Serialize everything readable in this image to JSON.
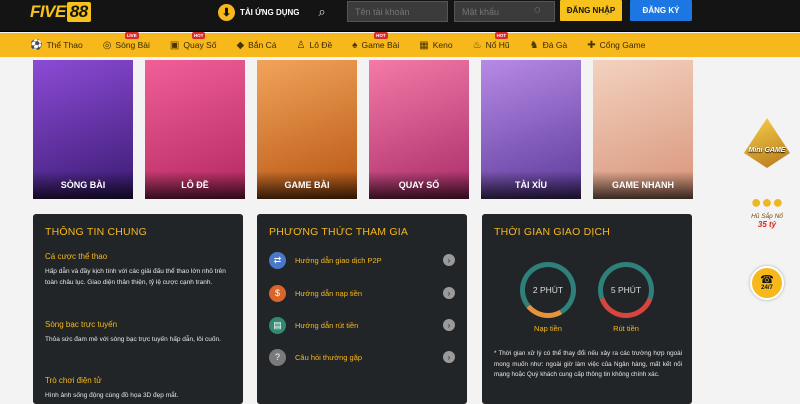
{
  "header": {
    "logo_part1": "FIVE",
    "logo_part2": "88",
    "app_download_label": "TẢI ỨNG DỤNG",
    "username_placeholder": "Tên tài khoản",
    "password_placeholder": "Mật khẩu",
    "login_label": "ĐĂNG NHẬP",
    "register_label": "ĐĂNG KÝ",
    "icons": [
      "download-icon",
      "search-icon",
      "eye-off-icon"
    ]
  },
  "nav": {
    "items": [
      {
        "label": "Thể Thao",
        "icon": "soccer-ball-icon",
        "badge": ""
      },
      {
        "label": "Sòng Bài",
        "icon": "casino-chip-icon",
        "badge": "LIVE"
      },
      {
        "label": "Quay Số",
        "icon": "lottery-icon",
        "badge": "HOT"
      },
      {
        "label": "Bắn Cá",
        "icon": "fish-icon",
        "badge": ""
      },
      {
        "label": "Lô Đề",
        "icon": "lotto-icon",
        "badge": ""
      },
      {
        "label": "Game Bài",
        "icon": "cards-icon",
        "badge": "HOT"
      },
      {
        "label": "Keno",
        "icon": "keno-icon",
        "badge": ""
      },
      {
        "label": "Nổ Hũ",
        "icon": "jar-icon",
        "badge": "HOT"
      },
      {
        "label": "Đá Gà",
        "icon": "rooster-icon",
        "badge": ""
      },
      {
        "label": "Cổng Game",
        "icon": "gamepad-icon",
        "badge": ""
      }
    ]
  },
  "cards": [
    {
      "label": "SÒNG BÀI",
      "color": "#8c4bd6"
    },
    {
      "label": "LÔ ĐỀ",
      "color": "#f15f98"
    },
    {
      "label": "GAME BÀI",
      "color": "#f2a45a"
    },
    {
      "label": "QUAY SỐ",
      "color": "#f47aa8"
    },
    {
      "label": "TÀI XỈU",
      "color": "#b78ae6"
    },
    {
      "label": "GAME NHANH",
      "color": "#f3d2c0"
    }
  ],
  "general_info": {
    "title": "THÔNG TIN CHUNG",
    "sections": [
      {
        "heading": "Cá cược thể thao",
        "text": "Hấp dẫn và đầy kịch tính với các giải đấu thể thao lớn nhỏ trên toàn châu lục. Giao diện thân thiện, tỷ lệ cược cạnh tranh."
      },
      {
        "heading": "Sòng bạc trực tuyến",
        "text": "Thỏa sức đam mê với sòng bạc trực tuyến hấp dẫn, lôi cuốn."
      },
      {
        "heading": "Trò chơi điện tử",
        "text": "Hình ảnh sống động cùng đồ họa 3D đẹp mắt."
      }
    ]
  },
  "participation": {
    "title": "PHƯƠNG THỨC THAM GIA",
    "guides": [
      {
        "label": "Hướng dẫn giao dịch P2P",
        "icon": "p2p-icon",
        "color": "#4a78c8"
      },
      {
        "label": "Hướng dẫn nạp tiền",
        "icon": "deposit-icon",
        "color": "#d9652a"
      },
      {
        "label": "Hướng dẫn rút tiền",
        "icon": "withdraw-icon",
        "color": "#2f8a6f"
      },
      {
        "label": "Câu hỏi thường gặp",
        "icon": "faq-icon",
        "color": "#7a7a7a"
      }
    ]
  },
  "transaction_time": {
    "title": "THỜI GIAN GIAO DỊCH",
    "deposit_time": "2 PHÚT",
    "deposit_label": "Nạp tiền",
    "withdraw_time": "5 PHÚT",
    "withdraw_label": "Rút tiền",
    "note": "* Thời gian xử lý có thể thay đổi nếu xảy ra các trường hợp ngoài mong muốn như: ngoài giờ làm việc của Ngân hàng, mất kết nối mạng hoặc Quý khách cung cấp thông tin không chính xác."
  },
  "side_widgets": {
    "mini_game_label": "Mini GAME",
    "jackpot_title": "Hũ Sắp Nổ",
    "jackpot_amount": "35 tỷ",
    "support_label": "24/7"
  }
}
